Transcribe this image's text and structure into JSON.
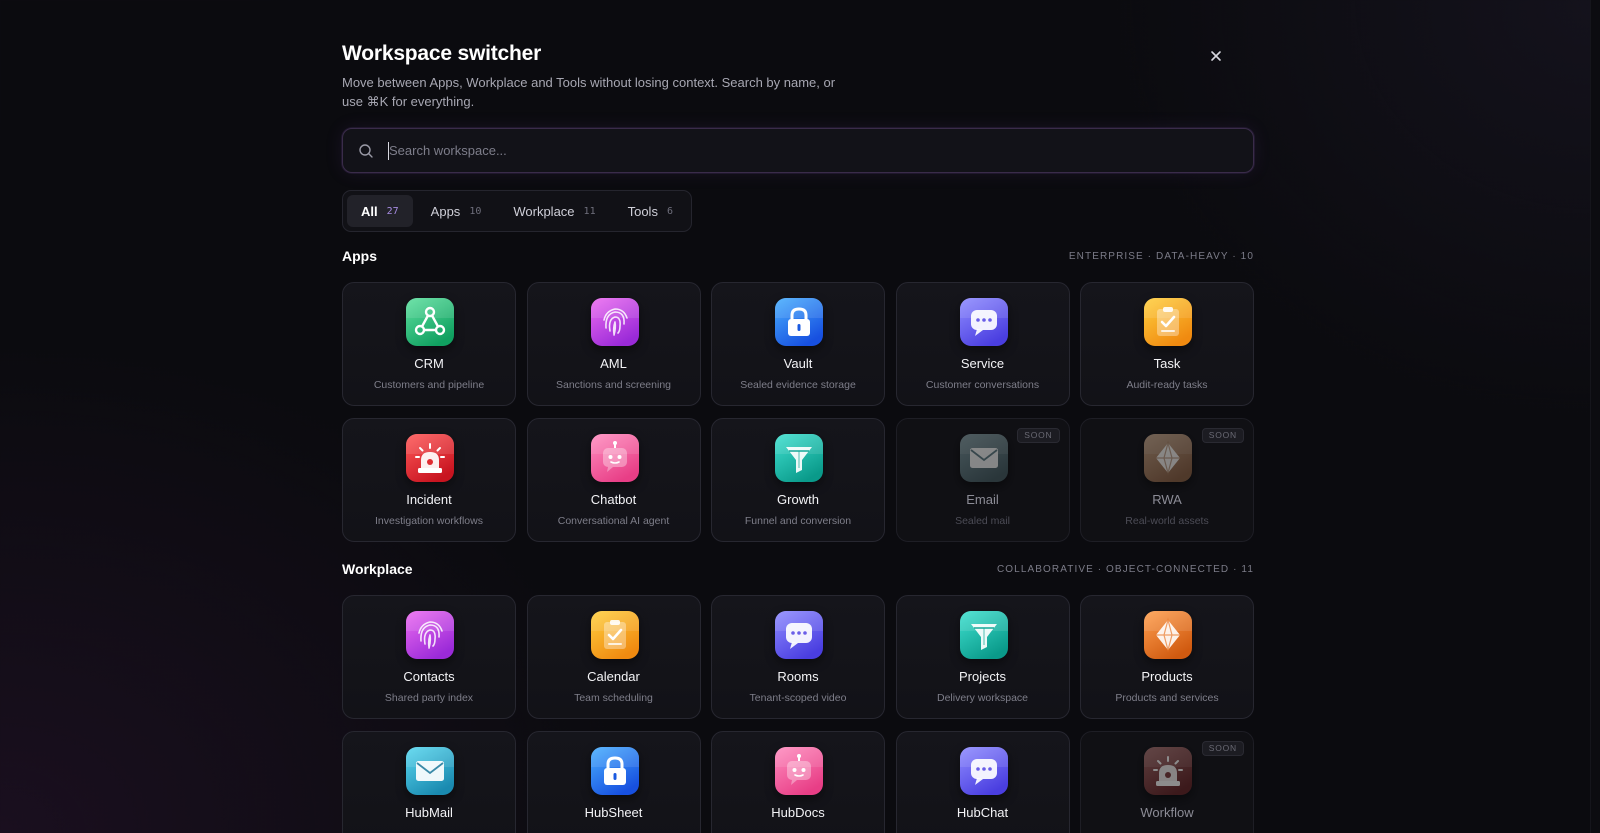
{
  "header": {
    "title": "Workspace switcher",
    "subtitle": "Move between Apps, Workplace and Tools without losing context. Search by name, or use ⌘K for everything."
  },
  "search": {
    "placeholder": "Search workspace...",
    "value": ""
  },
  "tabs": [
    {
      "label": "All",
      "count": "27",
      "active": true
    },
    {
      "label": "Apps",
      "count": "10",
      "active": false
    },
    {
      "label": "Workplace",
      "count": "11",
      "active": false
    },
    {
      "label": "Tools",
      "count": "6",
      "active": false
    }
  ],
  "sections": [
    {
      "title": "Apps",
      "meta": "ENTERPRISE · DATA-HEAVY · 10",
      "items": [
        {
          "name": "CRM",
          "desc": "Customers and pipeline",
          "icon": "network-icon",
          "colors": [
            "#5fe0a0",
            "#10a060"
          ],
          "soon": false
        },
        {
          "name": "AML",
          "desc": "Sanctions and screening",
          "icon": "fingerprint-icon",
          "colors": [
            "#ec6cf0",
            "#9a2ad8"
          ],
          "soon": false
        },
        {
          "name": "Vault",
          "desc": "Sealed evidence storage",
          "icon": "lock-icon",
          "colors": [
            "#4ab0ff",
            "#1750e0"
          ],
          "soon": false
        },
        {
          "name": "Service",
          "desc": "Customer conversations",
          "icon": "chat-bubble-icon",
          "colors": [
            "#8f8cff",
            "#4a3ee0"
          ],
          "soon": false
        },
        {
          "name": "Task",
          "desc": "Audit-ready tasks",
          "icon": "clipboard-check-icon",
          "colors": [
            "#ffd040",
            "#f08a10"
          ],
          "soon": false
        },
        {
          "name": "Incident",
          "desc": "Investigation workflows",
          "icon": "siren-icon",
          "colors": [
            "#ff5a5a",
            "#c81420"
          ],
          "soon": false
        },
        {
          "name": "Chatbot",
          "desc": "Conversational AI agent",
          "icon": "robot-icon",
          "colors": [
            "#ff8ec0",
            "#e83e86"
          ],
          "soon": false
        },
        {
          "name": "Growth",
          "desc": "Funnel and conversion",
          "icon": "funnel-icon",
          "colors": [
            "#40e0d0",
            "#0a9a8a"
          ],
          "soon": false
        },
        {
          "name": "Email",
          "desc": "Sealed mail",
          "icon": "envelope-icon",
          "colors": [
            "#5aa8c0",
            "#2a6a80"
          ],
          "soon": true,
          "badge": "SOON"
        },
        {
          "name": "RWA",
          "desc": "Real-world assets",
          "icon": "diamond-icon",
          "colors": [
            "#ffa050",
            "#d05a10"
          ],
          "soon": true,
          "badge": "SOON"
        }
      ]
    },
    {
      "title": "Workplace",
      "meta": "COLLABORATIVE · OBJECT-CONNECTED · 11",
      "items": [
        {
          "name": "Contacts",
          "desc": "Shared party index",
          "icon": "fingerprint-icon",
          "colors": [
            "#ec6cf0",
            "#9a2ad8"
          ],
          "soon": false
        },
        {
          "name": "Calendar",
          "desc": "Team scheduling",
          "icon": "clipboard-check-icon",
          "colors": [
            "#ffd040",
            "#f08a10"
          ],
          "soon": false
        },
        {
          "name": "Rooms",
          "desc": "Tenant-scoped video",
          "icon": "chat-bubble-icon",
          "colors": [
            "#8f8cff",
            "#4a3ee0"
          ],
          "soon": false
        },
        {
          "name": "Projects",
          "desc": "Delivery workspace",
          "icon": "funnel-icon",
          "colors": [
            "#40e0d0",
            "#0a9a8a"
          ],
          "soon": false
        },
        {
          "name": "Products",
          "desc": "Products and services",
          "icon": "diamond-icon",
          "colors": [
            "#ffa050",
            "#d05a10"
          ],
          "soon": false
        },
        {
          "name": "HubMail",
          "desc": "",
          "icon": "envelope-icon",
          "colors": [
            "#5ad8f0",
            "#1a8ab0"
          ],
          "soon": false
        },
        {
          "name": "HubSheet",
          "desc": "",
          "icon": "lock-icon",
          "colors": [
            "#4ab0ff",
            "#1750e0"
          ],
          "soon": false
        },
        {
          "name": "HubDocs",
          "desc": "",
          "icon": "robot-icon",
          "colors": [
            "#ff8ec0",
            "#e83e86"
          ],
          "soon": false
        },
        {
          "name": "HubChat",
          "desc": "",
          "icon": "chat-bubble-icon",
          "colors": [
            "#8f8cff",
            "#4a3ee0"
          ],
          "soon": false
        },
        {
          "name": "Workflow",
          "desc": "",
          "icon": "siren-icon",
          "colors": [
            "#ff5a5a",
            "#c81420"
          ],
          "soon": true,
          "badge": "SOON"
        }
      ]
    }
  ]
}
